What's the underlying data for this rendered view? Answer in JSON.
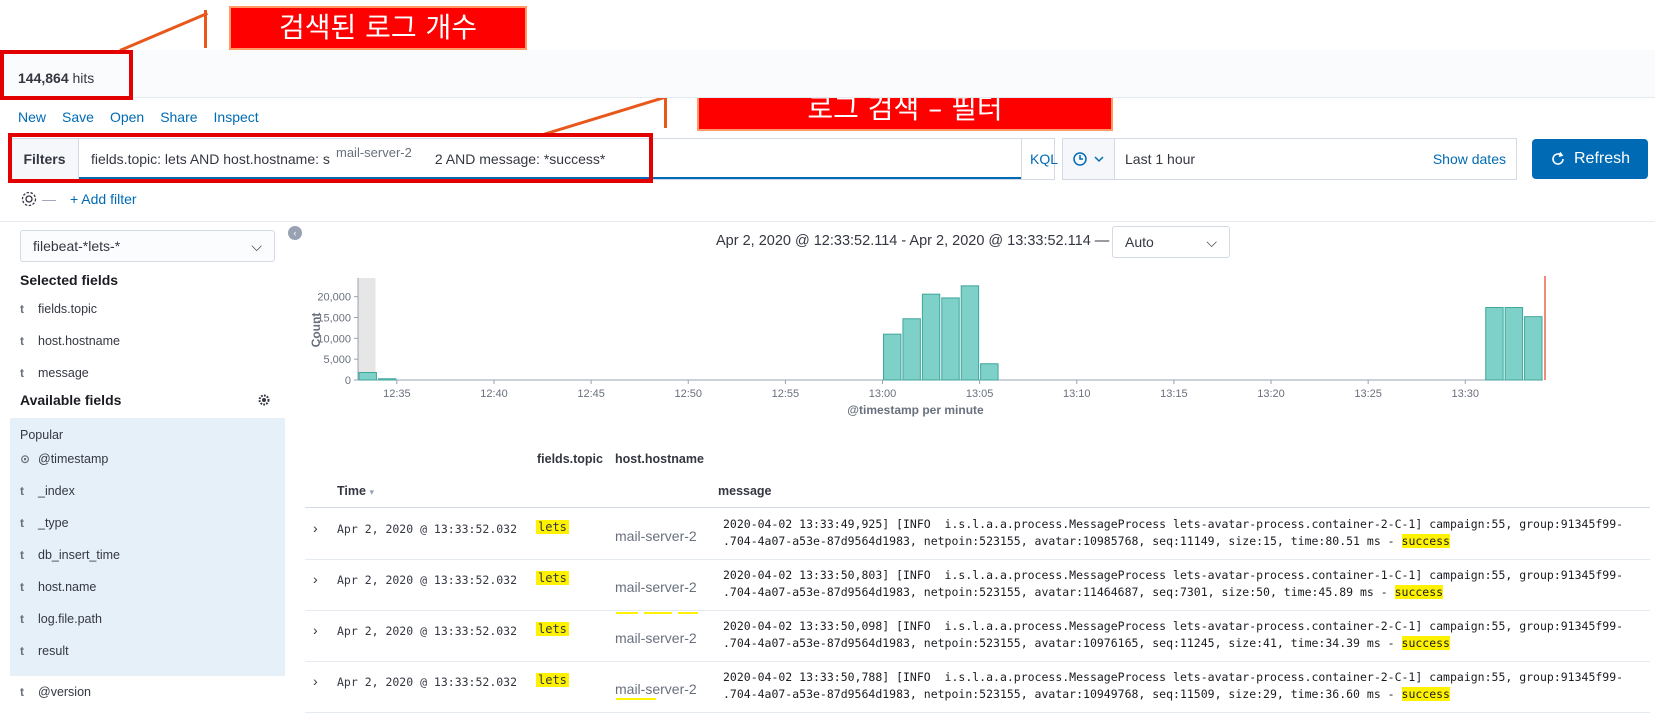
{
  "annotations": {
    "hits_callout": "검색된 로그 개수",
    "search_callout": "로그 검색 – 필터"
  },
  "hits": {
    "count": "144,864",
    "label": "hits"
  },
  "menu": {
    "new": "New",
    "save": "Save",
    "open": "Open",
    "share": "Share",
    "inspect": "Inspect"
  },
  "querybar": {
    "filters_label": "Filters",
    "query": "fields.topic: lets AND host.hostname: s",
    "query_tail": "2 AND message: *success*",
    "autocomplete_chip": "mail-server-2",
    "language": "KQL"
  },
  "datepicker": {
    "range": "Last 1 hour",
    "show_dates": "Show dates"
  },
  "refresh_label": "Refresh",
  "add_filter": "+ Add filter",
  "sidebar": {
    "index_pattern": "filebeat-*lets-*",
    "selected_title": "Selected fields",
    "selected": [
      {
        "type": "t",
        "name": "fields.topic"
      },
      {
        "type": "t",
        "name": "host.hostname"
      },
      {
        "type": "t",
        "name": "message"
      }
    ],
    "available_title": "Available fields",
    "popular_label": "Popular",
    "popular": [
      {
        "type": "clock",
        "name": "@timestamp"
      },
      {
        "type": "t",
        "name": "_index"
      },
      {
        "type": "t",
        "name": "_type"
      },
      {
        "type": "t",
        "name": "db_insert_time"
      },
      {
        "type": "t",
        "name": "host.name"
      },
      {
        "type": "t",
        "name": "log.file.path"
      },
      {
        "type": "t",
        "name": "result"
      }
    ],
    "other": [
      {
        "type": "t",
        "name": "@version"
      }
    ]
  },
  "chart_header": {
    "range": "Apr 2, 2020 @ 12:33:52.114 - Apr 2, 2020 @ 13:33:52.114 —",
    "interval": "Auto"
  },
  "chart_data": {
    "type": "bar",
    "xlabel": "@timestamp per minute",
    "ylabel": "Count",
    "ylim": [
      0,
      24000
    ],
    "y_ticks": [
      "0",
      "5,000",
      "10,000",
      "15,000",
      "20,000"
    ],
    "x_ticks": [
      "12:35",
      "12:40",
      "12:45",
      "12:50",
      "12:55",
      "13:00",
      "13:05",
      "13:10",
      "13:15",
      "13:20",
      "13:25",
      "13:30"
    ],
    "minutes": [
      "12:33",
      "12:34",
      "13:00",
      "13:01",
      "13:02",
      "13:03",
      "13:04",
      "13:05",
      "13:31",
      "13:32",
      "13:33"
    ],
    "values": [
      1800,
      300,
      11000,
      14700,
      20600,
      19700,
      22600,
      3900,
      17400,
      17400,
      15200
    ],
    "color": "#7dd1c9"
  },
  "table": {
    "headers": {
      "time": "Time",
      "topic": "fields.topic",
      "host": "host.hostname",
      "message": "message"
    },
    "rows": [
      {
        "time": "Apr 2, 2020 @ 13:33:52.032",
        "topic": "lets",
        "host": "mail-server-2",
        "msg1": "2020-04-02 13:33:49,925] [INFO  i.s.l.a.a.process.MessageProcess lets-avatar-process.container-2-C-1] campaign:55, group:91345f99-",
        "msg2": ".704-4a07-a53e-87d9564d1983, netpoin:523155, avatar:10985768, seq:11149, size:15, time:80.51 ms - ",
        "hl": "success"
      },
      {
        "time": "Apr 2, 2020 @ 13:33:52.032",
        "topic": "lets",
        "host": "mail-server-2",
        "msg1": "2020-04-02 13:33:50,803] [INFO  i.s.l.a.a.process.MessageProcess lets-avatar-process.container-1-C-1] campaign:55, group:91345f99-",
        "msg2": ".704-4a07-a53e-87d9564d1983, netpoin:523155, avatar:11464687, seq:7301, size:50, time:45.89 ms - ",
        "hl": "success"
      },
      {
        "time": "Apr 2, 2020 @ 13:33:52.032",
        "topic": "lets",
        "host": "mail-server-2",
        "msg1": "2020-04-02 13:33:50,098] [INFO  i.s.l.a.a.process.MessageProcess lets-avatar-process.container-2-C-1] campaign:55, group:91345f99-",
        "msg2": ".704-4a07-a53e-87d9564d1983, netpoin:523155, avatar:10976165, seq:11245, size:41, time:34.39 ms - ",
        "hl": "success"
      },
      {
        "time": "Apr 2, 2020 @ 13:33:52.032",
        "topic": "lets",
        "host": "mail-server-2",
        "msg1": "2020-04-02 13:33:50,788] [INFO  i.s.l.a.a.process.MessageProcess lets-avatar-process.container-2-C-1] campaign:55, group:91345f99-",
        "msg2": ".704-4a07-a53e-87d9564d1983, netpoin:523155, avatar:10949768, seq:11509, size:29, time:36.60 ms - ",
        "hl": "success"
      }
    ]
  }
}
